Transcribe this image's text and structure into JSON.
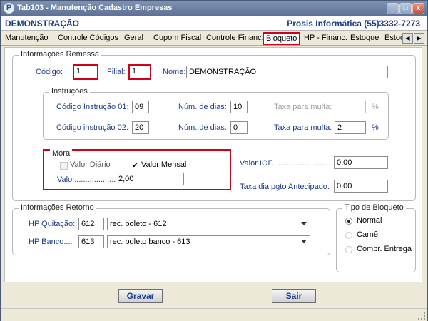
{
  "window": {
    "title": "Tab103 - Manutenção Cadastro Empresas",
    "app_icon_letter": "P",
    "minimize": "_",
    "maximize": "□",
    "close": "x"
  },
  "banner": {
    "company": "DEMONSTRAÇÃO",
    "vendor": "Prosis Informática (55)3332-7273"
  },
  "tabs": [
    {
      "label": "Manutenção"
    },
    {
      "label": "Controle Códigos"
    },
    {
      "label": "Geral"
    },
    {
      "label": "Cupom Fiscal"
    },
    {
      "label": "Controle Financ."
    },
    {
      "label": "Bloqueto",
      "active": true
    },
    {
      "label": "HP - Financ."
    },
    {
      "label": "Estoque"
    },
    {
      "label": "Estoq"
    }
  ],
  "tab_scroll": {
    "left": "◀",
    "right": "▶"
  },
  "remessa": {
    "legend": "Informações Remessa",
    "codigo_label": "Código:",
    "codigo_value": "1",
    "filial_label": "Filial:",
    "filial_value": "1",
    "nome_label": "Nome:",
    "nome_value": "DEMONSTRAÇÃO"
  },
  "instrucoes": {
    "legend": "Instruções",
    "cod1_label": "Código Instrução 01:",
    "cod1_value": "09",
    "dias1_label": "Núm. de dias:",
    "dias1_value": "10",
    "taxa1_label": "Taxa para multa:",
    "taxa1_value": "",
    "pct1": "%",
    "cod2_label": "Código instrução 02:",
    "cod2_value": "20",
    "dias2_label": "Núm. de dias:",
    "dias2_value": "0",
    "taxa2_label": "Taxa para multa:",
    "taxa2_value": "2",
    "pct2": "%"
  },
  "mora": {
    "legend": "Mora",
    "valor_diario_label": "Valor Diário",
    "valor_diario_checked": false,
    "valor_mensal_label": "Valor Mensal",
    "valor_mensal_checked": true,
    "check_mark": "✔",
    "valor_label": "Valor.......................:",
    "valor_value": "2,00"
  },
  "iof": {
    "label": "Valor IOF..............................:",
    "value": "0,00",
    "taxa_label": "Taxa dia pgto Antecipado:",
    "taxa_value": "0,00"
  },
  "retorno": {
    "legend": "Informações Retorno",
    "quitacao_label": "HP Quitação:",
    "quitacao_code": "612",
    "quitacao_desc": "rec. boleto  - 612",
    "banco_label": "HP Banco...:",
    "banco_code": "613",
    "banco_desc": "rec. boleto banco - 613"
  },
  "tipo_bloqueto": {
    "legend": "Tipo de Bloqueto",
    "options": [
      {
        "label": "Normal",
        "selected": true
      },
      {
        "label": "Carnê",
        "selected": false
      },
      {
        "label": "Compr. Entrega",
        "selected": false
      }
    ]
  },
  "buttons": {
    "gravar": "Gravar",
    "sair": "Sair"
  }
}
